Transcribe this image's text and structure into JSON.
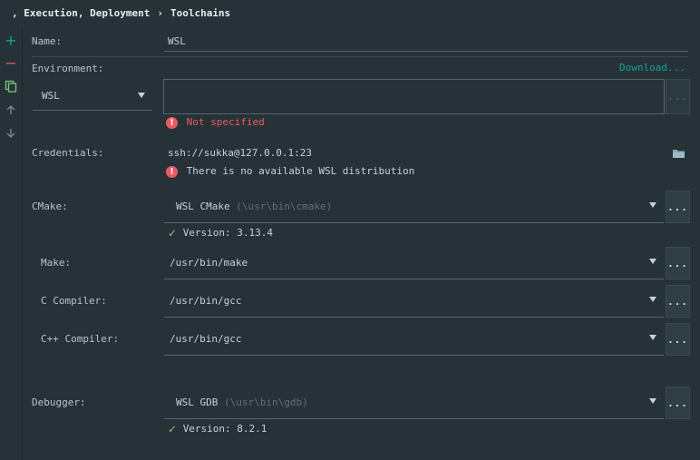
{
  "breadcrumb": {
    "parent": ", Execution, Deployment",
    "separator": "›",
    "current": "Toolchains"
  },
  "toolbar": {
    "add": "+",
    "remove": "−"
  },
  "name": {
    "label": "Name:",
    "value": "WSL"
  },
  "environment": {
    "label": "Environment:",
    "download_link": "Download...",
    "select_value": "WSL",
    "path_value": "",
    "path_button": "...",
    "error": "Not specified"
  },
  "credentials": {
    "label": "Credentials:",
    "value": "ssh://sukka@127.0.0.1:23",
    "error": "There is no available WSL distribution"
  },
  "cmake": {
    "label": "CMake:",
    "value": "WSL CMake",
    "hint": "(\\usr\\bin\\cmake)",
    "button": "...",
    "version": "Version: 3.13.4"
  },
  "make": {
    "label": "Make:",
    "value": "/usr/bin/make",
    "button": "..."
  },
  "c_compiler": {
    "label": "C Compiler:",
    "value": "/usr/bin/gcc",
    "button": "..."
  },
  "cpp_compiler": {
    "label": "C++ Compiler:",
    "value": "/usr/bin/gcc",
    "button": "..."
  },
  "debugger": {
    "label": "Debugger:",
    "value": "WSL GDB",
    "hint": "(\\usr\\bin\\gdb)",
    "button": "...",
    "version": "Version: 8.2.1"
  },
  "colors": {
    "background": "#263238",
    "accent": "#16a29b",
    "error": "#ec5a63",
    "success": "#7fc47a"
  }
}
